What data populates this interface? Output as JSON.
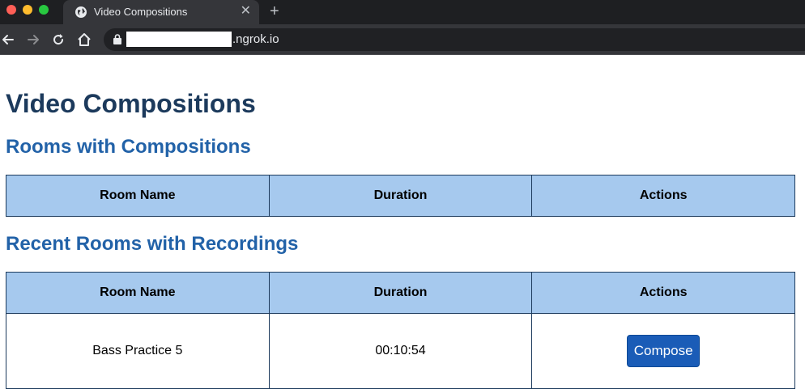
{
  "browser": {
    "tab_title": "Video Compositions",
    "tab_close": "✕",
    "new_tab": "+",
    "url_suffix": ".ngrok.io"
  },
  "page": {
    "title": "Video Compositions",
    "section1": {
      "heading": "Rooms with Compositions",
      "headers": [
        "Room Name",
        "Duration",
        "Actions"
      ]
    },
    "section2": {
      "heading": "Recent Rooms with Recordings",
      "headers": [
        "Room Name",
        "Duration",
        "Actions"
      ],
      "rows": [
        {
          "room_name": "Bass Practice 5",
          "duration": "00:10:54",
          "action": "Compose"
        }
      ]
    }
  },
  "colors": {
    "heading_dark": "#1c3a5c",
    "heading_blue": "#2262a8",
    "table_header_bg": "#a6c9ee",
    "button_bg": "#1a5cb7"
  }
}
